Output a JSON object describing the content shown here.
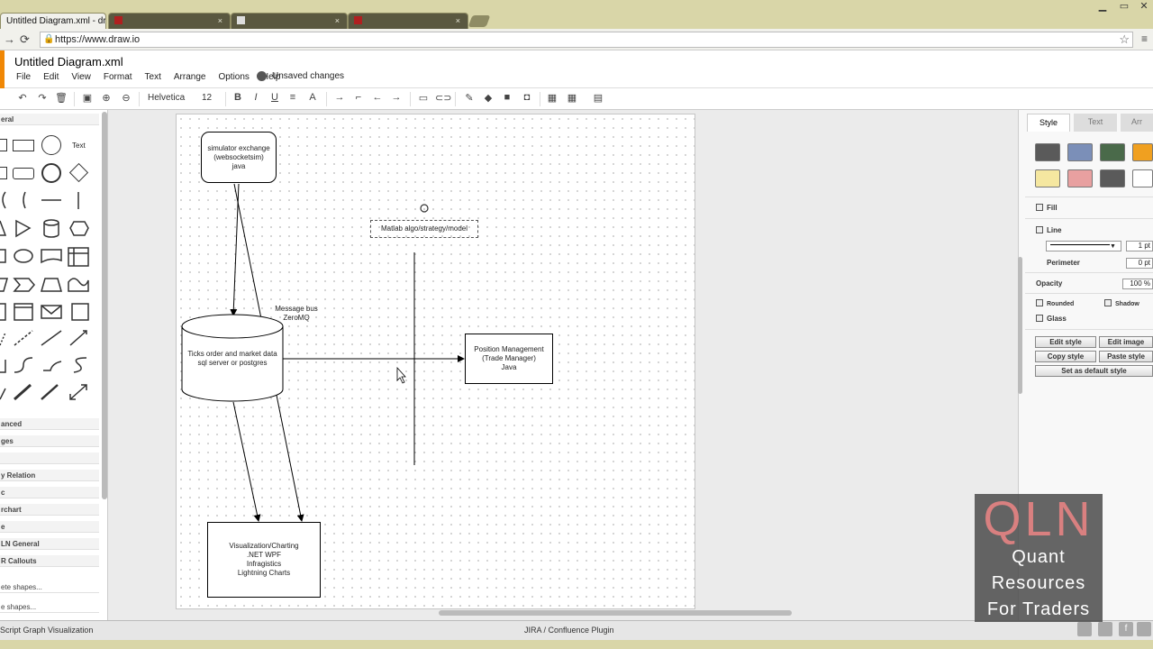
{
  "browser": {
    "tabs": [
      {
        "title": "Untitled Diagram.xml - dr.",
        "close": "×"
      },
      {
        "title": "",
        "close": "×"
      },
      {
        "title": "",
        "close": "×"
      },
      {
        "title": "",
        "close": "×"
      }
    ],
    "url": "https://www.draw.io",
    "back": "←",
    "forward": "→",
    "reload": "⟳",
    "star": "☆",
    "menu": "≡",
    "lock": "🔒",
    "minimize": "▁",
    "restore": "▭",
    "close_window": "✕"
  },
  "app": {
    "document_title": "Untitled Diagram.xml",
    "menus": [
      "File",
      "Edit",
      "View",
      "Format",
      "Text",
      "Arrange",
      "Options",
      "Help"
    ],
    "status": "Unsaved changes",
    "toolbar": {
      "undo": "↶",
      "redo": "↷",
      "delete": "🗑",
      "fit": "▣",
      "zoom_in": "⊕",
      "zoom_out": "⊖",
      "font": "Helvetica",
      "font_size": "12",
      "bold": "B",
      "italic": "I",
      "underline": "U",
      "align": "≡",
      "text_color": "A",
      "connector": "→",
      "waypoints": "⌐",
      "arrow_left": "←",
      "arrow_right": "→",
      "image": "▭",
      "link": "⊂⊃",
      "line_color": "✎",
      "fill_color": "◆",
      "shadow": "■",
      "copy_style": "◘",
      "grid": "▦",
      "guides": "▦",
      "outline": "▤"
    }
  },
  "left_panel": {
    "sections": [
      "eral",
      "anced",
      "ges",
      "",
      "y Relation",
      "c",
      "rchart",
      "e",
      "LN General",
      "R Callouts",
      "ete shapes...",
      "e shapes..."
    ],
    "text_shape_label": "Text"
  },
  "diagram": {
    "nodes": {
      "simulator": [
        "simulator exchange",
        "(websocketsim)",
        "java"
      ],
      "database": [
        "Ticks order and market data",
        "sql server or postgres"
      ],
      "position": [
        "Position Management",
        "(Trade Manager)",
        "Java"
      ],
      "visualization": [
        "Visualization/Charting",
        ".NET WPF",
        "Infragistics",
        "Lightning Charts"
      ],
      "matlab": "Matlab  algo/strategy/model"
    },
    "labels": {
      "message_bus": [
        "Message bus",
        "ZeroMQ"
      ]
    }
  },
  "right_panel": {
    "tabs": [
      "Style",
      "Text",
      "Arr"
    ],
    "swatch_colors": [
      "#5a5a5a",
      "#7b8fb8",
      "#4a6a4a",
      "#f0a020",
      "#f5e7a0",
      "#e8a0a0",
      "#5a5a5a",
      "#ffffff"
    ],
    "fill_label": "Fill",
    "line_label": "Line",
    "line_width": "1 pt",
    "perimeter_label": "Perimeter",
    "perimeter_value": "0 pt",
    "opacity_label": "Opacity",
    "opacity_value": "100 %",
    "rounded_label": "Rounded",
    "shadow_label": "Shadow",
    "glass_label": "Glass",
    "buttons": {
      "edit_style": "Edit style",
      "edit_image": "Edit image",
      "copy_style": "Copy style",
      "paste_style": "Paste style",
      "set_default": "Set as default style"
    }
  },
  "bottom": {
    "left_item": "Script Graph Visualization",
    "center_item": "JIRA / Confluence Plugin"
  },
  "watermark": {
    "logo": "QLN",
    "line1": "Quant",
    "line2": "Resources",
    "line3": "For Traders"
  }
}
